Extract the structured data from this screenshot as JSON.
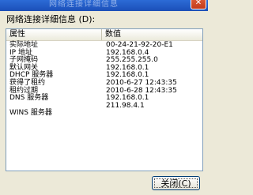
{
  "window": {
    "title": "网络连接详细信息",
    "close_glyph": "✕"
  },
  "heading": "网络连接详细信息 (D):",
  "columns": {
    "property": "属性",
    "value": "数值"
  },
  "rows": [
    {
      "property": "实际地址",
      "value": "00-24-21-92-20-E1"
    },
    {
      "property": "IP 地址",
      "value": "192.168.0.4"
    },
    {
      "property": "子网掩码",
      "value": "255.255.255.0"
    },
    {
      "property": "默认网关",
      "value": "192.168.0.1"
    },
    {
      "property": "DHCP 服务器",
      "value": "192.168.0.1"
    },
    {
      "property": "获得了租约",
      "value": "2010-6-27 12:43:35"
    },
    {
      "property": "租约过期",
      "value": "2010-6-28 12:43:35"
    },
    {
      "property": "DNS 服务器",
      "value": "192.168.0.1"
    },
    {
      "property": "",
      "value": "211.98.4.1"
    },
    {
      "property": "WINS 服务器",
      "value": ""
    }
  ],
  "buttons": {
    "close": "关闭(C)"
  }
}
